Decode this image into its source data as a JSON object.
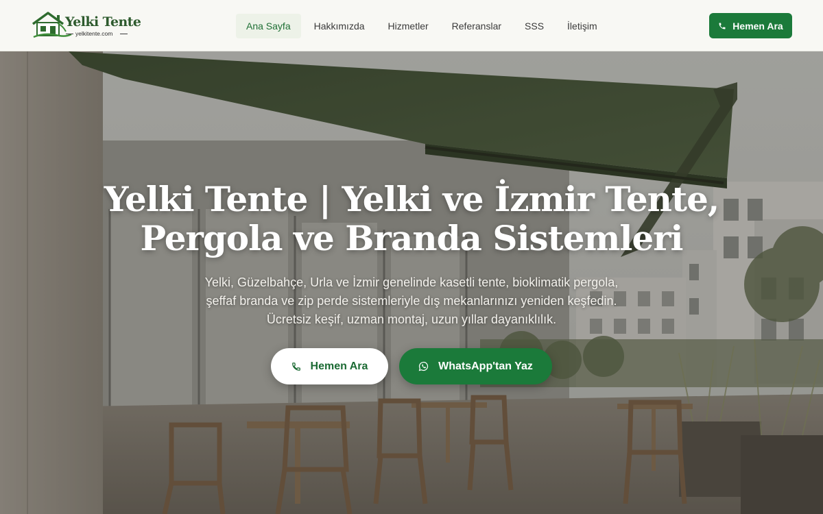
{
  "header": {
    "logo": {
      "title": "Yelki Tente",
      "subtitle": "yelkitente.com"
    },
    "nav": [
      {
        "label": "Ana Sayfa",
        "active": true
      },
      {
        "label": "Hakkımızda",
        "active": false
      },
      {
        "label": "Hizmetler",
        "active": false
      },
      {
        "label": "Referanslar",
        "active": false
      },
      {
        "label": "SSS",
        "active": false
      },
      {
        "label": "İletişim",
        "active": false
      }
    ],
    "call_button": {
      "label": "Hemen Ara",
      "icon": "phone-icon"
    }
  },
  "hero": {
    "title_line1": "Yelki Tente | Yelki ve İzmir Tente,",
    "title_line2": "Pergola ve Branda Sistemleri",
    "description_line1": "Yelki, Güzelbahçe, Urla ve İzmir genelinde kasetli tente, bioklimatik pergola,",
    "description_line2": "şeffaf branda ve zip perde sistemleriyle dış mekanlarınızı yeniden keşfedin.",
    "description_line3": "Ücretsiz keşif, uzman montaj, uzun yıllar dayanıklılık.",
    "buttons": {
      "call": {
        "label": "Hemen Ara",
        "icon": "phone-icon"
      },
      "whatsapp": {
        "label": "WhatsApp'tan Yaz",
        "icon": "whatsapp-icon"
      }
    }
  },
  "colors": {
    "brand_green": "#1b7a3a",
    "header_bg": "#f8f8f4",
    "nav_active_bg": "#edf2e8",
    "awning_green": "#3d4f34"
  }
}
